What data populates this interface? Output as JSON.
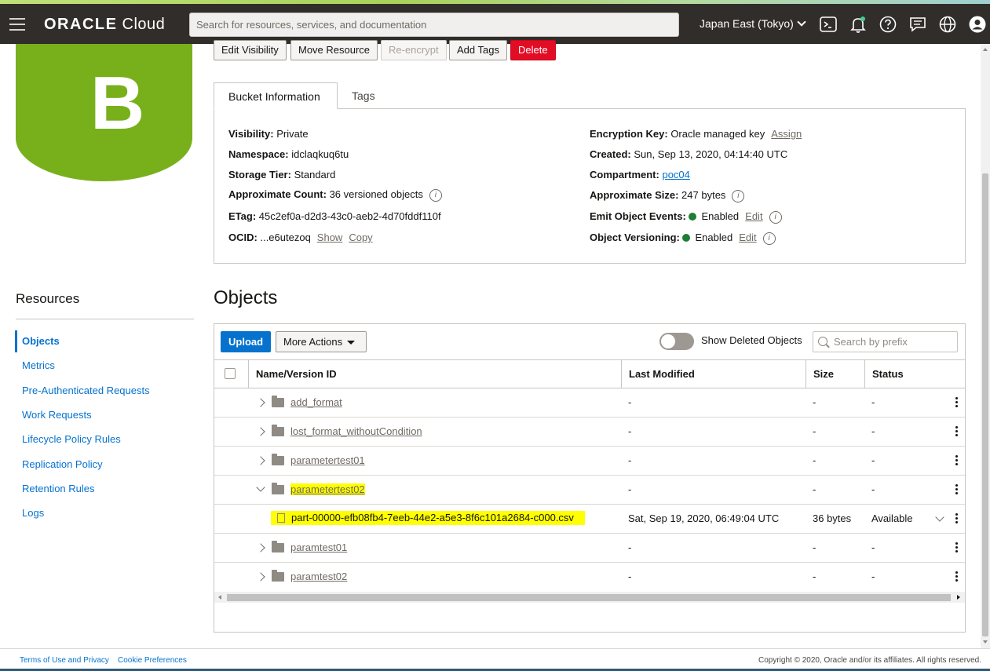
{
  "header": {
    "logo_bold": "ORACLE",
    "logo_light": "Cloud",
    "search_placeholder": "Search for resources, services, and documentation",
    "region": "Japan East (Tokyo)"
  },
  "bucket": {
    "icon_letter": "B",
    "icon_color": "#78b01c"
  },
  "actions": {
    "edit_visibility": "Edit Visibility",
    "move_resource": "Move Resource",
    "re_encrypt": "Re-encrypt",
    "add_tags": "Add Tags",
    "delete": "Delete"
  },
  "tabs": {
    "bucket_info": "Bucket Information",
    "tags": "Tags"
  },
  "info": {
    "visibility_k": "Visibility:",
    "visibility_v": "Private",
    "namespace_k": "Namespace:",
    "namespace_v": "idclaqkuq6tu",
    "storage_k": "Storage Tier:",
    "storage_v": "Standard",
    "count_k": "Approximate Count:",
    "count_v": "36 versioned objects",
    "etag_k": "ETag:",
    "etag_v": "45c2ef0a-d2d3-43c0-aeb2-4d70fddf110f",
    "ocid_k": "OCID:",
    "ocid_v": "...e6utezoq",
    "show": "Show",
    "copy": "Copy",
    "enc_k": "Encryption Key:",
    "enc_v": "Oracle managed key",
    "assign": "Assign",
    "created_k": "Created:",
    "created_v": "Sun, Sep 13, 2020, 04:14:40 UTC",
    "compartment_k": "Compartment:",
    "compartment_v": "poc04",
    "size_k": "Approximate Size:",
    "size_v": "247 bytes",
    "emit_k": "Emit Object Events:",
    "emit_v": "Enabled",
    "edit": "Edit",
    "versioning_k": "Object Versioning:",
    "versioning_v": "Enabled"
  },
  "resources": {
    "title": "Resources",
    "items": [
      "Objects",
      "Metrics",
      "Pre-Authenticated Requests",
      "Work Requests",
      "Lifecycle Policy Rules",
      "Replication Policy",
      "Retention Rules",
      "Logs"
    ]
  },
  "objects": {
    "title": "Objects",
    "upload": "Upload",
    "more_actions": "More Actions",
    "show_deleted": "Show Deleted Objects",
    "search_placeholder": "Search by prefix",
    "columns": {
      "name": "Name/Version ID",
      "modified": "Last Modified",
      "size": "Size",
      "status": "Status"
    },
    "rows": [
      {
        "name": "add_format",
        "modified": "-",
        "size": "-",
        "status": "-"
      },
      {
        "name": "lost_format_withoutCondition",
        "modified": "-",
        "size": "-",
        "status": "-"
      },
      {
        "name": "parametertest01",
        "modified": "-",
        "size": "-",
        "status": "-"
      },
      {
        "name": "parametertest02",
        "modified": "-",
        "size": "-",
        "status": "-"
      },
      {
        "name": "part-00000-efb08fb4-7eeb-44e2-a5e3-8f6c101a2684-c000.csv",
        "modified": "Sat, Sep 19, 2020, 06:49:04 UTC",
        "size": "36 bytes",
        "status": "Available"
      },
      {
        "name": "paramtest01",
        "modified": "-",
        "size": "-",
        "status": "-"
      },
      {
        "name": "paramtest02",
        "modified": "-",
        "size": "-",
        "status": "-"
      }
    ]
  },
  "footer": {
    "terms": "Terms of Use and Privacy",
    "cookies": "Cookie Preferences",
    "copyright": "Copyright © 2020, Oracle and/or its affiliates. All rights reserved."
  }
}
